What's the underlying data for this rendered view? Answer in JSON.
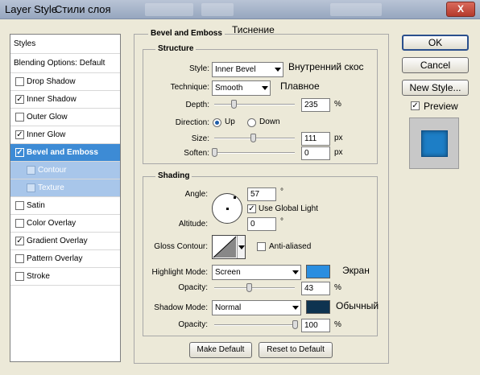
{
  "window": {
    "title": "Layer Style",
    "title_ru": "Стили слоя",
    "close": "X"
  },
  "styles_panel": {
    "header": "Styles",
    "blending": "Blending Options: Default",
    "items": [
      {
        "label": "Drop Shadow",
        "checked": false,
        "check": ""
      },
      {
        "label": "Inner Shadow",
        "checked": true,
        "check": "✓"
      },
      {
        "label": "Outer Glow",
        "checked": false,
        "check": ""
      },
      {
        "label": "Inner Glow",
        "checked": true,
        "check": "✓"
      },
      {
        "label": "Bevel and Emboss",
        "checked": true,
        "check": "✓"
      },
      {
        "label": "Contour",
        "checked": false,
        "check": ""
      },
      {
        "label": "Texture",
        "checked": false,
        "check": ""
      },
      {
        "label": "Satin",
        "checked": false,
        "check": ""
      },
      {
        "label": "Color Overlay",
        "checked": false,
        "check": ""
      },
      {
        "label": "Gradient Overlay",
        "checked": true,
        "check": "✓"
      },
      {
        "label": "Pattern Overlay",
        "checked": false,
        "check": ""
      },
      {
        "label": "Stroke",
        "checked": false,
        "check": ""
      }
    ]
  },
  "bevel": {
    "title": "Bevel and Emboss",
    "title_ru": "Тиснение",
    "structure": {
      "title": "Structure",
      "style_label": "Style:",
      "style_value": "Inner Bevel",
      "style_ru": "Внутренний скос",
      "technique_label": "Technique:",
      "technique_value": "Smooth",
      "technique_ru": "Плавное",
      "depth_label": "Depth:",
      "depth_value": "235",
      "depth_unit": "%",
      "depth_slider": 0.24,
      "direction_label": "Direction:",
      "up_label": "Up",
      "down_label": "Down",
      "direction": "Up",
      "size_label": "Size:",
      "size_value": "111",
      "size_unit": "px",
      "size_slider": 0.48,
      "soften_label": "Soften:",
      "soften_value": "0",
      "soften_unit": "px",
      "soften_slider": 0.0
    },
    "shading": {
      "title": "Shading",
      "angle_label": "Angle:",
      "angle_value": "57",
      "angle_unit": "°",
      "global_light_label": "Use Global Light",
      "global_light_checked": true,
      "global_light_check": "✓",
      "altitude_label": "Altitude:",
      "altitude_value": "0",
      "altitude_unit": "°",
      "gloss_label": "Gloss Contour:",
      "anti_aliased_label": "Anti-aliased",
      "anti_aliased_checked": false,
      "highlight_label": "Highlight Mode:",
      "highlight_value": "Screen",
      "highlight_color": "#2a8ee0",
      "highlight_ru": "Экран",
      "highlight_opacity_label": "Opacity:",
      "highlight_opacity_value": "43",
      "highlight_opacity_unit": "%",
      "highlight_slider": 0.43,
      "shadow_label": "Shadow Mode:",
      "shadow_value": "Normal",
      "shadow_color": "#0e3350",
      "shadow_ru": "Обычный",
      "shadow_opacity_label": "Opacity:",
      "shadow_opacity_value": "100",
      "shadow_opacity_unit": "%",
      "shadow_slider": 1.0
    },
    "make_default": "Make Default",
    "reset_default": "Reset to Default"
  },
  "buttons": {
    "ok": "OK",
    "cancel": "Cancel",
    "new_style": "New Style...",
    "preview_label": "Preview",
    "preview_checked": true,
    "preview_check": "✓"
  },
  "colors": {
    "selection": "#3d8bd5",
    "preview_swatch": "#1d7ec6"
  }
}
